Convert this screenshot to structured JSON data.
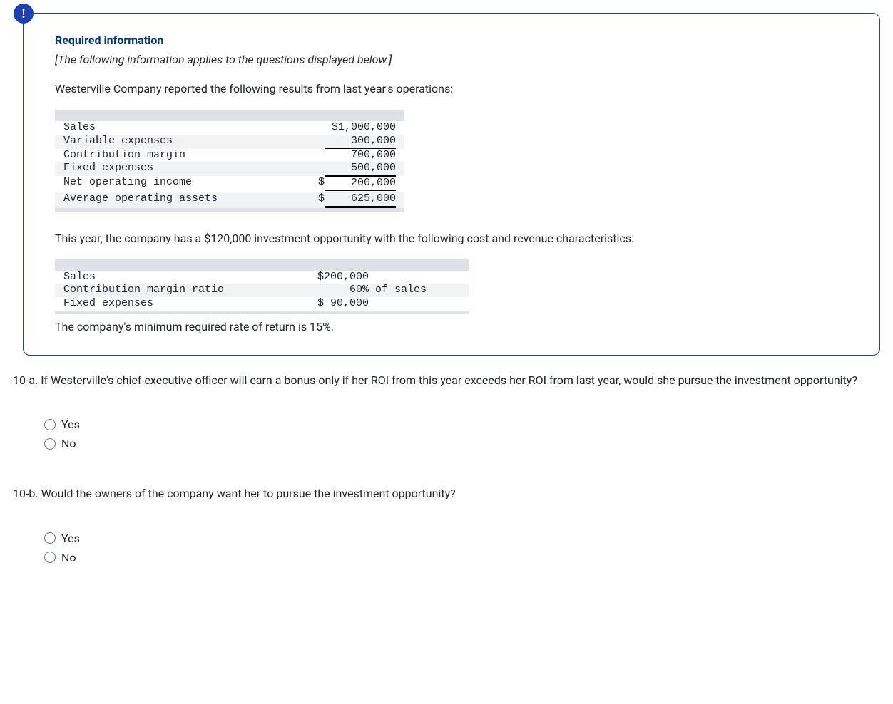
{
  "badge": "!",
  "info": {
    "title": "Required information",
    "note": "[The following information applies to the questions displayed below.]",
    "intro": "Westerville Company reported the following results from last year's operations:",
    "table1": {
      "rows": [
        {
          "label": "Sales",
          "sym": "",
          "val": "$1,000,000",
          "alt": false,
          "cls": ""
        },
        {
          "label": "Variable expenses",
          "sym": "",
          "val": "300,000",
          "alt": true,
          "cls": "underline-single"
        },
        {
          "label": "Contribution margin",
          "sym": "",
          "val": "700,000",
          "alt": false,
          "cls": ""
        },
        {
          "label": "Fixed expenses",
          "sym": "",
          "val": "500,000",
          "alt": true,
          "cls": "underline-single"
        },
        {
          "label": "Net operating income",
          "sym": "$",
          "val": "200,000",
          "alt": false,
          "cls": "underline-double underline-top"
        },
        {
          "label": "Average operating assets",
          "sym": "$",
          "val": "625,000",
          "alt": true,
          "cls": "underline-double"
        }
      ]
    },
    "mid": "This year, the company has a $120,000 investment opportunity with the following cost and revenue characteristics:",
    "table2": {
      "rows": [
        {
          "label": "Sales",
          "val": "$200,000",
          "alt": false
        },
        {
          "label": "Contribution margin ratio",
          "val": "     60% of sales",
          "alt": true
        },
        {
          "label": "Fixed expenses",
          "val": "$ 90,000",
          "alt": false
        }
      ]
    },
    "closing": "The company's minimum required rate of return is 15%."
  },
  "q10a": {
    "text": "10-a. If Westerville's chief executive officer will earn a bonus only if her ROI from this year exceeds her ROI from last year, would she pursue the investment opportunity?",
    "options": [
      "Yes",
      "No"
    ]
  },
  "q10b": {
    "text": "10-b. Would the owners of the company want her to pursue the investment opportunity?",
    "options": [
      "Yes",
      "No"
    ]
  }
}
